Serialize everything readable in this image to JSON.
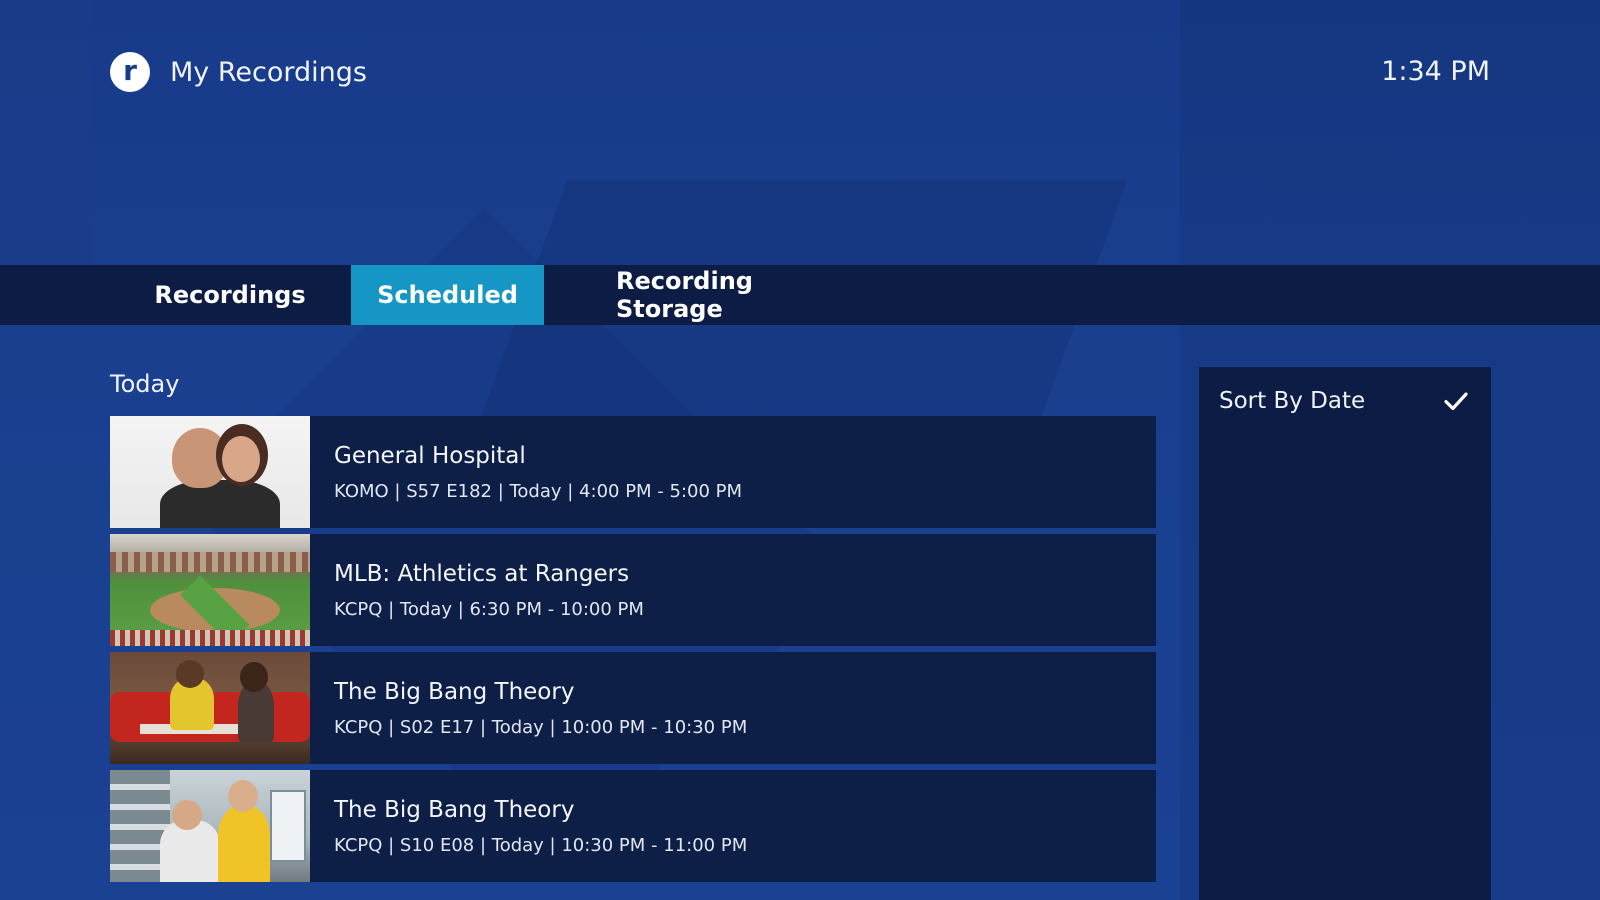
{
  "header": {
    "logo_letter": "r",
    "title": "My Recordings",
    "time": "1:34 PM"
  },
  "tabs": [
    {
      "label": "Recordings",
      "active": false
    },
    {
      "label": "Scheduled",
      "active": true
    },
    {
      "label": "Recording Storage",
      "active": false
    }
  ],
  "section": {
    "title": "Today"
  },
  "recordings": [
    {
      "title": "General Hospital",
      "meta": "KOMO |  S57 E182 | Today | 4:00 PM - 5:00 PM"
    },
    {
      "title": "MLB: Athletics at Rangers",
      "meta": "KCPQ | Today | 6:30 PM - 10:00 PM"
    },
    {
      "title": "The Big Bang Theory",
      "meta": "KCPQ |  S02 E17 | Today | 10:00 PM - 10:30 PM"
    },
    {
      "title": "The Big Bang Theory",
      "meta": "KCPQ |  S10 E08 | Today | 10:30 PM - 11:00 PM"
    }
  ],
  "sort_panel": {
    "option_label": "Sort By Date",
    "selected": true,
    "icon": "check-icon"
  },
  "colors": {
    "background": "#173b8a",
    "tabbar": "#0c1c44",
    "active_tab": "#1596c4",
    "row": "#0d1e47"
  }
}
